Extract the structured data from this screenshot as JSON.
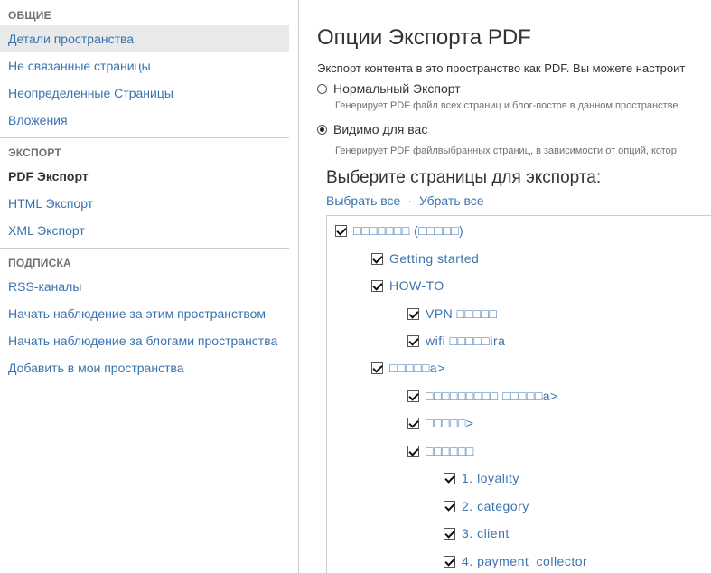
{
  "sidebar": {
    "sections": [
      {
        "heading": "ОБЩИЕ",
        "items": [
          {
            "label": "Детали пространства",
            "selected": true
          },
          {
            "label": "Не связанные страницы"
          },
          {
            "label": "Неопределенные Страницы"
          },
          {
            "label": "Вложения"
          }
        ]
      },
      {
        "heading": "ЭКСПОРТ",
        "items": [
          {
            "label": "PDF Экспорт",
            "active": true
          },
          {
            "label": "HTML Экспорт"
          },
          {
            "label": "XML Экспорт"
          }
        ]
      },
      {
        "heading": "ПОДПИСКА",
        "items": [
          {
            "label": "RSS-каналы"
          },
          {
            "label": "Начать наблюдение за этим пространством"
          },
          {
            "label": "Начать наблюдение за блогами пространства"
          },
          {
            "label": "Добавить в мои пространства"
          }
        ]
      }
    ]
  },
  "main": {
    "title": "Опции Экспорта PDF",
    "intro": "Экспорт контента в это пространство как PDF. Вы можете настроит",
    "options": [
      {
        "label": "Нормальный Экспорт",
        "description": "Генерирует PDF файл всех страниц и блог-постов в данном пространстве",
        "checked": false
      },
      {
        "label": "Видимо для вас",
        "description": "Генерирует PDF файлвыбранных страниц, в зависимости от опций, котор",
        "checked": true
      }
    ],
    "select_heading": "Выберите страницы для экспорта:",
    "select_all": "Выбрать все",
    "separator": "·",
    "deselect_all": "Убрать все",
    "tree": [
      {
        "label": "□□□□□□□ (□□□□□)",
        "level": 0,
        "checked": true
      },
      {
        "label": "Getting started",
        "level": 1,
        "checked": true
      },
      {
        "label": "HOW-TO",
        "level": 1,
        "checked": true
      },
      {
        "label": "VPN □□□□□",
        "level": 2,
        "checked": true
      },
      {
        "label": "wifi □□□□□ira",
        "level": 2,
        "checked": true
      },
      {
        "label": "□□□□□a>",
        "level": 1,
        "checked": true
      },
      {
        "label": "□□□□□□□□□ □□□□□a>",
        "level": 2,
        "checked": true
      },
      {
        "label": "□□□□□>",
        "level": 2,
        "checked": true
      },
      {
        "label": "□□□□□□",
        "level": 2,
        "checked": true
      },
      {
        "label": "1. loyality",
        "level": 3,
        "checked": true
      },
      {
        "label": "2. category",
        "level": 3,
        "checked": true
      },
      {
        "label": "3. client",
        "level": 3,
        "checked": true
      },
      {
        "label": "4. payment_collector",
        "level": 3,
        "checked": true
      }
    ]
  }
}
